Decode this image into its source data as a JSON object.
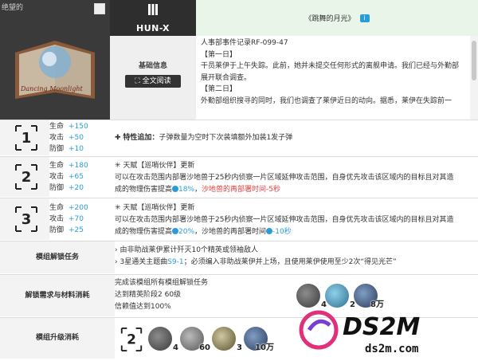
{
  "header": {
    "watermark": "绝望的",
    "book_caption": "Dancing Moonlight",
    "operator_name": "HUN-X",
    "basic_info_label": "基础信息",
    "full_text_button": "⛶ 全文阅读",
    "title": "《跳舞的月光》",
    "info_badge": "i"
  },
  "doc": {
    "lines": [
      "人事部事件记录RF-099-47",
      "【第一日】",
      "干员莱伊于上午失踪。此前，她并未提交任何形式的离舰申请。我们已经与外勤部展开联合调查。",
      "【第二日】",
      "外勤部组织搜寻的同时，我们也调查了莱伊近日的动向。据悉，莱伊在失踪前一"
    ]
  },
  "stats_labels": {
    "hp": "生命",
    "atk": "攻击",
    "def": "防御"
  },
  "stage1": {
    "hp": "+150",
    "atk": "+50",
    "def": "+10",
    "effect_title": "特性追加：",
    "effect_text": "子弹数量为空时下次装填额外加装1发子弹"
  },
  "stage2": {
    "hp": "+180",
    "atk": "+65",
    "def": "+20",
    "talent": "天赋【巡哨伙伴】更新",
    "line1": "可以在攻击范围内部署沙地兽于25秒内侦察一片区域延伸攻击范围，自身优先攻击该区域内的目标且对其造",
    "line2a": "成的物理伤害提高",
    "line2b": "18%",
    "line2c": "，",
    "line2d": "沙地兽的再部署时间-5秒"
  },
  "stage3": {
    "hp": "+200",
    "atk": "+70",
    "def": "+25",
    "talent": "天赋【巡哨伙伴】更新",
    "line1": "可以在攻击范围内部署沙地兽于25秒内侦察一片区域延伸攻击范围，自身优先攻击该区域内的目标且对其造",
    "line2a": "成的物理伤害提高",
    "line2b": "20%",
    "line2c": "，沙地兽的再部署时间",
    "line2d": "-10秒"
  },
  "unlock": {
    "label": "模组解锁任务",
    "task1": "由非助战莱伊累计歼灭10个精英或领袖敌人",
    "task2a": "3星通关主题曲",
    "task2b": "S9-1",
    "task2c": "；必须编入非助战莱伊并上场，且使用莱伊使用至少2次“得见光芒”"
  },
  "requirements": {
    "label": "解锁需求与材料消耗",
    "line1": "完成该模组所有模组解锁任务",
    "line2": "达到精英阶段2 60级",
    "line3": "信赖值达到100%",
    "mats": [
      "4",
      "2",
      "8万"
    ]
  },
  "upgrade": {
    "label": "模组升级消耗",
    "mats": [
      "4",
      "60",
      "3",
      "10万"
    ]
  },
  "brand": {
    "logo": "DS2M",
    "url": "ds2m.com"
  },
  "colors": {
    "accent": "#2a9dd8",
    "negative": "#e04040",
    "dark": "#2e2e2e",
    "title_bg": "#eaf5ea"
  }
}
